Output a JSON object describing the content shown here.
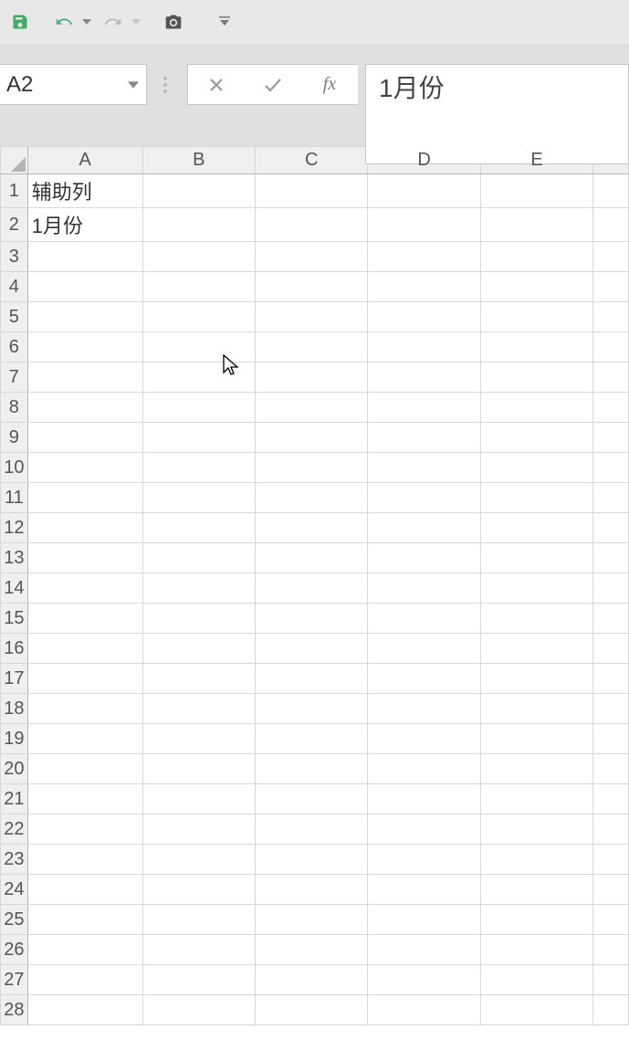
{
  "qat": {
    "icons": {
      "save": "save-icon",
      "undo": "undo-icon",
      "redo": "redo-icon",
      "camera": "camera-icon",
      "more": "more-icon"
    }
  },
  "formulaBar": {
    "nameBox": "A2",
    "formula": "1月份"
  },
  "grid": {
    "columns": [
      "A",
      "B",
      "C",
      "D",
      "E",
      ""
    ],
    "rows": [
      "1",
      "2",
      "3",
      "4",
      "5",
      "6",
      "7",
      "8",
      "9",
      "10",
      "11",
      "12",
      "13",
      "14",
      "15",
      "16",
      "17",
      "18",
      "19",
      "20",
      "21",
      "22",
      "23",
      "24",
      "25",
      "26",
      "27",
      "28"
    ],
    "cells": {
      "A1": "辅助列",
      "A2": "1月份"
    }
  }
}
